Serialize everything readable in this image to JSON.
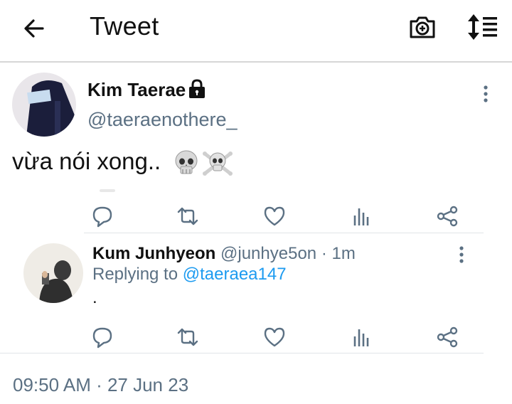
{
  "header": {
    "title": "Tweet",
    "icons": [
      "back-arrow-icon",
      "camera-plus-icon",
      "sort-icon"
    ]
  },
  "tweet": {
    "author_name": "Kim Taerae",
    "author_handle": "@taeraenothere_",
    "locked_icon": "lock-icon",
    "text": "vừa nói xong..",
    "emojis": [
      "skull",
      "skull-and-crossbones"
    ],
    "actions": [
      "reply-icon",
      "retweet-icon",
      "like-icon",
      "analytics-icon",
      "share-icon"
    ]
  },
  "reply": {
    "author_name": "Kum Junhyeon",
    "author_handle": "@junhye5on",
    "separator": "·",
    "time": "1m",
    "replying_label": "Replying to",
    "replying_to": "@taeraea147",
    "text": ".",
    "actions": [
      "reply-icon",
      "retweet-icon",
      "like-icon",
      "analytics-icon",
      "share-icon"
    ]
  },
  "timestamp": "09:50 AM · 27 Jun 23",
  "colors": {
    "muted": "#5b7083",
    "link": "#1d9bf0",
    "divider": "#e1e5e8"
  }
}
